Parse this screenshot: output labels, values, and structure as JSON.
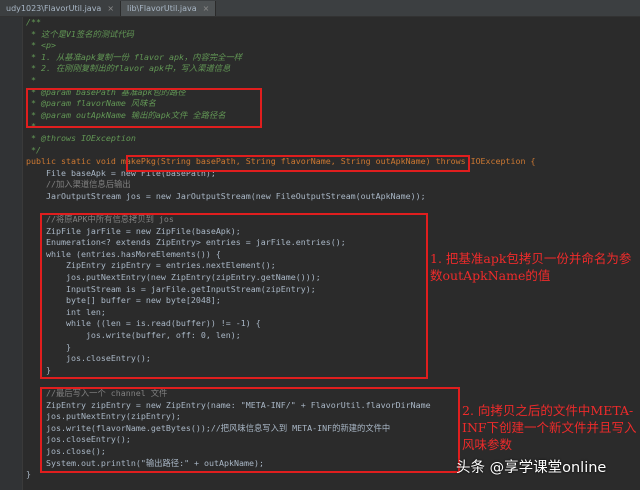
{
  "tabs": [
    {
      "label": "udy1023\\FlavorUtil.java",
      "active": false
    },
    {
      "label": "lib\\FlavorUtil.java",
      "active": true
    }
  ],
  "code_lines": [
    "/**",
    " * 这个是V1签名的测试代码",
    " * <p>",
    " * 1. 从基准apk复制一份 flavor apk，内容完全一样",
    " * 2. 在刚刚复制出的flavor apk中，写入渠道信息",
    " *",
    " * @param basePath 基准apk包的路径",
    " * @param flavorName 风味名",
    " * @param outApkName 输出的apk文件 全路径名",
    " *",
    " * @throws IOException",
    " */",
    "public static void makePkg(String basePath, String flavorName, String outApkName) throws IOException {",
    "    File baseApk = new File(basePath);",
    "    //加入渠道信息后输出",
    "    JarOutputStream jos = new JarOutputStream(new FileOutputStream(outApkName));",
    "",
    "    //将原APK中所有信息拷贝到 jos",
    "    ZipFile jarFile = new ZipFile(baseApk);",
    "    Enumeration<? extends ZipEntry> entries = jarFile.entries();",
    "    while (entries.hasMoreElements()) {",
    "        ZipEntry zipEntry = entries.nextElement();",
    "        jos.putNextEntry(new ZipEntry(zipEntry.getName()));",
    "        InputStream is = jarFile.getInputStream(zipEntry);",
    "        byte[] buffer = new byte[2048];",
    "        int len;",
    "        while ((len = is.read(buffer)) != -1) {",
    "            jos.write(buffer, off: 0, len);",
    "        }",
    "        jos.closeEntry();",
    "    }",
    "",
    "    //最后写入一个 channel 文件",
    "    ZipEntry zipEntry = new ZipEntry(name: \"META-INF/\" + FlavorUtil.flavorDirName",
    "    jos.putNextEntry(zipEntry);",
    "    jos.write(flavorName.getBytes());//把风味信息写入到 META-INF的新建的文件中",
    "    jos.closeEntry();",
    "    jos.close();",
    "    System.out.println(\"输出路径:\" + outApkName);",
    "}"
  ],
  "annotations": {
    "note1": "1. 把基准apk包拷贝一份并命名为参数outApkName的值",
    "note2": "2. 向拷贝之后的文件中META-INF下创建一个新文件并且写入风味参数"
  },
  "watermark": "头条 @享学课堂online",
  "colors": {
    "annotation_red": "#e01e1e",
    "background": "#2b2b2b"
  }
}
